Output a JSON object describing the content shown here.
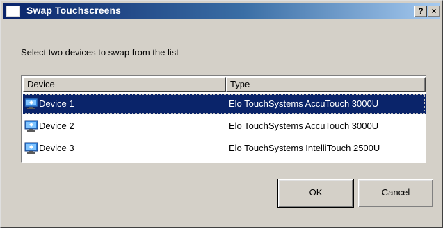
{
  "window": {
    "title": "Swap Touchscreens",
    "help_label": "?",
    "close_label": "×"
  },
  "prompt": "Select two devices to swap from the list",
  "list": {
    "columns": [
      "Device",
      "Type"
    ],
    "rows": [
      {
        "device": "Device 1",
        "type": "Elo TouchSystems AccuTouch 3000U",
        "selected": true
      },
      {
        "device": "Device 2",
        "type": "Elo TouchSystems AccuTouch 3000U",
        "selected": false
      },
      {
        "device": "Device 3",
        "type": "Elo TouchSystems IntelliTouch 2500U",
        "selected": false
      }
    ]
  },
  "buttons": {
    "ok": "OK",
    "cancel": "Cancel"
  },
  "colors": {
    "selection": "#0a246a",
    "face": "#d4d0c8"
  },
  "icons": {
    "row_icon": "monitor-icon",
    "app_icon": "window-icon"
  }
}
